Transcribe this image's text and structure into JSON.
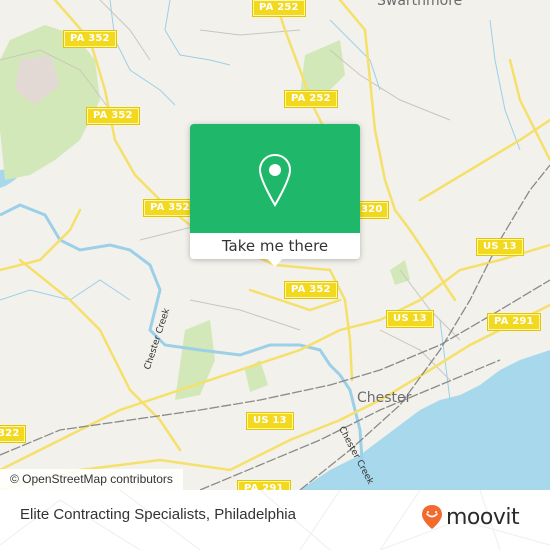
{
  "map": {
    "road_shields": [
      {
        "label": "PA 352",
        "id": "pa352-a"
      },
      {
        "label": "PA 352",
        "id": "pa352-b"
      },
      {
        "label": "PA 352",
        "id": "pa352-c"
      },
      {
        "label": "PA 352",
        "id": "pa352-d"
      },
      {
        "label": "PA 252",
        "id": "pa252-a"
      },
      {
        "label": "PA 252",
        "id": "pa252-b"
      },
      {
        "label": "320",
        "id": "pa320"
      },
      {
        "label": "US 13",
        "id": "us13-a"
      },
      {
        "label": "US 13",
        "id": "us13-b"
      },
      {
        "label": "US 13",
        "id": "us13-c"
      },
      {
        "label": "PA 291",
        "id": "pa291-a"
      },
      {
        "label": "PA 291",
        "id": "pa291-b"
      },
      {
        "label": "322",
        "id": "us322"
      }
    ],
    "places": {
      "swarthmore": "Swarthmore",
      "chester": "Chester",
      "chester_creek_1": "Chester Creek",
      "chester_creek_2": "Chester Creek"
    },
    "colors": {
      "land": "#f2f1ec",
      "water": "#a8d8ec",
      "park": "#d3e8b8",
      "road": "#f5e06a",
      "rail": "#888888",
      "accent": "#1fb86a"
    }
  },
  "popup": {
    "icon": "location-pin-icon",
    "button_label": "Take me there"
  },
  "attribution": "© OpenStreetMap contributors",
  "footer": {
    "title": "Elite Contracting Specialists, Philadelphia",
    "brand": "moovit",
    "brand_icon": "moovit-smile-pin-icon"
  }
}
